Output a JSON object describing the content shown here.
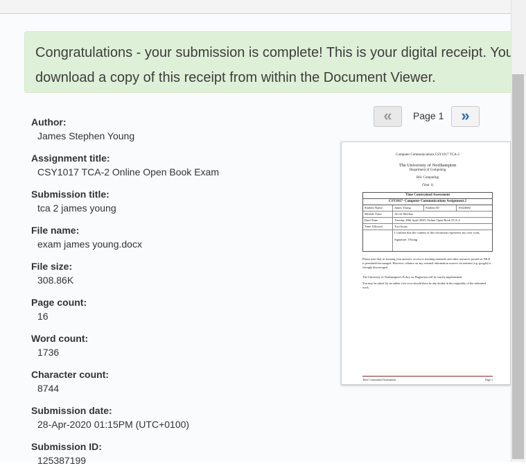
{
  "alert": {
    "message": "Congratulations - your submission is complete! This is your digital receipt. You can download a copy of this receipt from within the Document Viewer."
  },
  "fields": [
    {
      "label": "Author:",
      "value": "James Stephen Young"
    },
    {
      "label": "Assignment title:",
      "value": "CSY1017 TCA-2 Online Open Book Exam"
    },
    {
      "label": "Submission title:",
      "value": "tca 2 james young"
    },
    {
      "label": "File name:",
      "value": "exam james young.docx"
    },
    {
      "label": "File size:",
      "value": "308.86K"
    },
    {
      "label": "Page count:",
      "value": "16"
    },
    {
      "label": "Word count:",
      "value": "1736"
    },
    {
      "label": "Character count:",
      "value": "8744"
    },
    {
      "label": "Submission date:",
      "value": "28-Apr-2020 01:15PM (UTC+0100)"
    },
    {
      "label": "Submission ID:",
      "value": "125387199"
    }
  ],
  "pager": {
    "prev_label": "«",
    "next_label": "»",
    "page_label": "Page 1"
  },
  "preview": {
    "header": "Computer Communications CSY1017 TCA-2",
    "university": "The University of Northampton",
    "department": "Department of Computing",
    "course": "BSc Computing",
    "year": "(Year 1)",
    "box_title1": "Time Constrained Assessment",
    "box_title2": "CSY1017- Computer Communications Assignment 2",
    "student_name_label": "Student Name:",
    "student_name": "James Young",
    "student_id_label": "Student ID",
    "student_id": "19424682",
    "tutor_label": "Module Tutor",
    "tutor": "Ali Al-Sherbaz",
    "datetime_label": "Date/Time",
    "datetime": "Tuesday 28th April 2020, Online Open Book TCA-2",
    "time_label": "Time Allowed",
    "time": "Two hours",
    "confirm": "I confirm that the content of this document represents my own work,",
    "signature": "Signature: JYoung",
    "note1": "Please note that, in forming your answers, access to teaching materials and other resources posted on NILE is permitted/encouraged. However, reliance on any external information sources via internet (e.g. google) is strongly discouraged.",
    "note2": "The University of Northampton's Policy on Plagiarism will be strictly implemented.",
    "note3": "You may be asked for an online viva-voce should there be any doubts in the originality of the submitted work.",
    "footer_left": "Time Constrained Assessment",
    "footer_right": "Page 1"
  },
  "colors": {
    "alert_bg": "#dff0d8",
    "next_arrow": "#2a6fb8"
  }
}
